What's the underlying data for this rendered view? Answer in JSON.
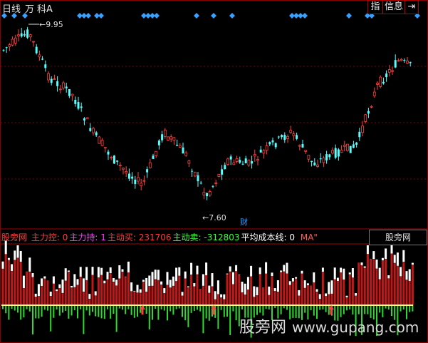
{
  "toolbar": {
    "period": "日线",
    "wan": "万",
    "ke": "科A",
    "btn_index": "指",
    "btn_info": "信息",
    "btn_arrow": "⇥"
  },
  "price_chart": {
    "high_label": "9.95",
    "low_label": "7.60",
    "event_marker": "财"
  },
  "indicator": {
    "name": "股旁网",
    "items": [
      {
        "label": "主力控:",
        "value": "0",
        "color": "#ff3b3b"
      },
      {
        "label": "主力持:",
        "value": "1",
        "color": "#ff40ff"
      },
      {
        "label": "主动买:",
        "value": "231706",
        "color": "#ff3b3b"
      },
      {
        "label": "主动卖:",
        "value": "-312803",
        "color": "#3cff3c"
      },
      {
        "label": "平均成本线:",
        "value": "0",
        "color": "#ffffff"
      }
    ],
    "ma_label": "MA\""
  },
  "indicator_tab": "股旁网",
  "watermark": {
    "cn": "股旁网",
    "url": "www.gupang.com"
  },
  "colors": {
    "up": "#ff4040",
    "down": "#54ffff",
    "diamond": "#3aa0ff",
    "buy_bar": "#c01818",
    "sell_bar": "#30d830",
    "baseline": "#ffff80"
  }
}
